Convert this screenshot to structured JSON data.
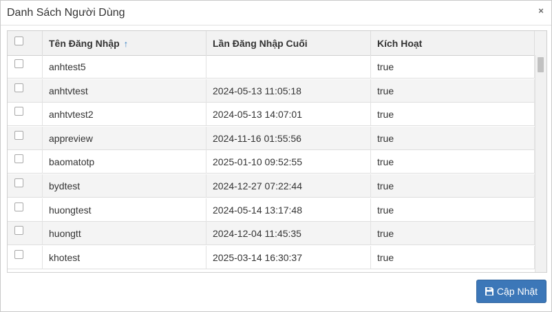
{
  "dialog": {
    "title": "Danh Sách Người Dùng",
    "close_label": "×"
  },
  "grid": {
    "columns": [
      {
        "label": "",
        "type": "select-all"
      },
      {
        "label": "Tên Đăng Nhập",
        "sort": "ascending"
      },
      {
        "label": "Lần Đăng Nhập Cuối"
      },
      {
        "label": "Kích Hoạt"
      }
    ],
    "rows": [
      {
        "username": "anhtest5",
        "last_login": "",
        "active": "true"
      },
      {
        "username": "anhtvtest",
        "last_login": "2024-05-13 11:05:18",
        "active": "true"
      },
      {
        "username": "anhtvtest2",
        "last_login": "2024-05-13 14:07:01",
        "active": "true"
      },
      {
        "username": "appreview",
        "last_login": "2024-11-16 01:55:56",
        "active": "true"
      },
      {
        "username": "baomatotp",
        "last_login": "2025-01-10 09:52:55",
        "active": "true"
      },
      {
        "username": "bydtest",
        "last_login": "2024-12-27 07:22:44",
        "active": "true"
      },
      {
        "username": "huongtest",
        "last_login": "2024-05-14 13:17:48",
        "active": "true"
      },
      {
        "username": "huongtt",
        "last_login": "2024-12-04 11:45:35",
        "active": "true"
      },
      {
        "username": "khotest",
        "last_login": "2025-03-14 16:30:37",
        "active": "true"
      }
    ]
  },
  "footer": {
    "update_label": "Cập Nhật",
    "update_icon": "save-icon"
  },
  "colors": {
    "primary_button": "#3c77b8",
    "sort_arrow": "#3b82c4",
    "row_alt": "#f4f4f4"
  }
}
